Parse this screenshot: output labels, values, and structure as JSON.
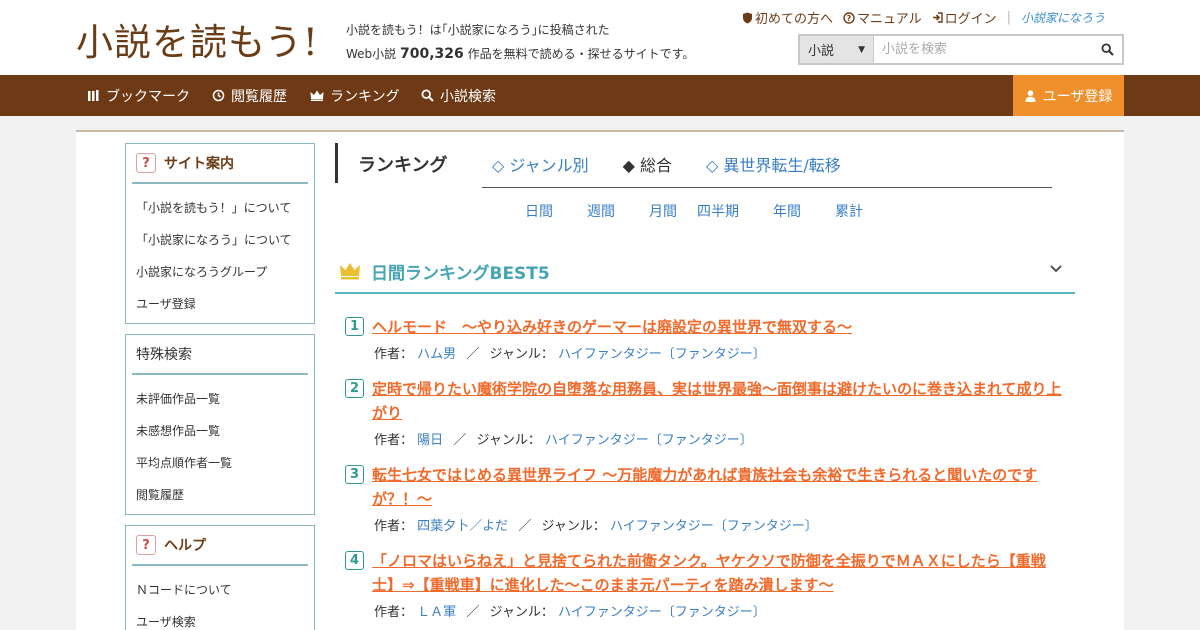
{
  "header": {
    "logo": "小説を読もう!",
    "tagline_line1": "小説を読もう！は｢小説家になろう｣に投稿された",
    "tagline_prefix": "Web小説",
    "tagline_count": "700,326",
    "tagline_suffix": "作品を無料で読める・探せるサイトです。",
    "top_links": [
      {
        "label": "初めての方へ",
        "icon": "shield-icon"
      },
      {
        "label": "マニュアル",
        "icon": "help-circle-icon"
      },
      {
        "label": "ログイン",
        "icon": "login-icon"
      }
    ],
    "partner_logo": "小説家になろう",
    "search": {
      "category": "小説",
      "placeholder": "小説を検索"
    }
  },
  "nav": {
    "items": [
      {
        "label": "ブックマーク",
        "icon": "bookmark-icon"
      },
      {
        "label": "閲覧履歴",
        "icon": "history-icon"
      },
      {
        "label": "ランキング",
        "icon": "crown-icon"
      },
      {
        "label": "小説検索",
        "icon": "search-icon"
      }
    ],
    "register": "ユーザ登録"
  },
  "sidebar": {
    "site_guide": {
      "title": "サイト案内",
      "items": [
        "「小説を読もう！」について",
        "「小説家になろう」について",
        "小説家になろうグループ",
        "ユーザ登録"
      ]
    },
    "special_search": {
      "title": "特殊検索",
      "items": [
        "未評価作品一覧",
        "未感想作品一覧",
        "平均点順作者一覧",
        "閲覧履歴"
      ]
    },
    "help": {
      "title": "ヘルプ",
      "items": [
        "Ｎコードについて",
        "ユーザ検索"
      ]
    }
  },
  "ranking": {
    "title": "ランキング",
    "tabs": [
      {
        "label": "◇ ジャンル別",
        "active": false
      },
      {
        "label": "◆ 総合",
        "active": true
      },
      {
        "label": "◇ 異世界転生/転移",
        "active": false
      }
    ],
    "periods": [
      "日間",
      "週間",
      "月間",
      "四半期",
      "年間",
      "累計"
    ],
    "best_title": "日間ランキングBEST5",
    "author_label": "作者：",
    "genre_label": "ジャンル：",
    "entries": [
      {
        "rank": "1",
        "title": "ヘルモード　～やり込み好きのゲーマーは廃設定の異世界で無双する～",
        "author": "ハム男",
        "genre": "ハイファンタジー〔ファンタジー〕"
      },
      {
        "rank": "2",
        "title": "定時で帰りたい魔術学院の自堕落な用務員、実は世界最強～面倒事は避けたいのに巻き込まれて成り上がり",
        "author": "陽日",
        "genre": "ハイファンタジー〔ファンタジー〕"
      },
      {
        "rank": "3",
        "title": "転生七女ではじめる異世界ライフ 〜万能魔力があれば貴族社会も余裕で生きられると聞いたのですが？！〜",
        "author": "四葉夕卜／よだ",
        "genre": "ハイファンタジー〔ファンタジー〕"
      },
      {
        "rank": "4",
        "title": "「ノロマはいらねえ」と見捨てられた前衛タンク。ヤケクソで防御を全振りでＭＡＸにしたら【重戦士】⇒【重戦車】に進化した～このまま元パーティを踏み潰します～",
        "author": "ＬＡ軍",
        "genre": "ハイファンタジー〔ファンタジー〕"
      }
    ]
  }
}
